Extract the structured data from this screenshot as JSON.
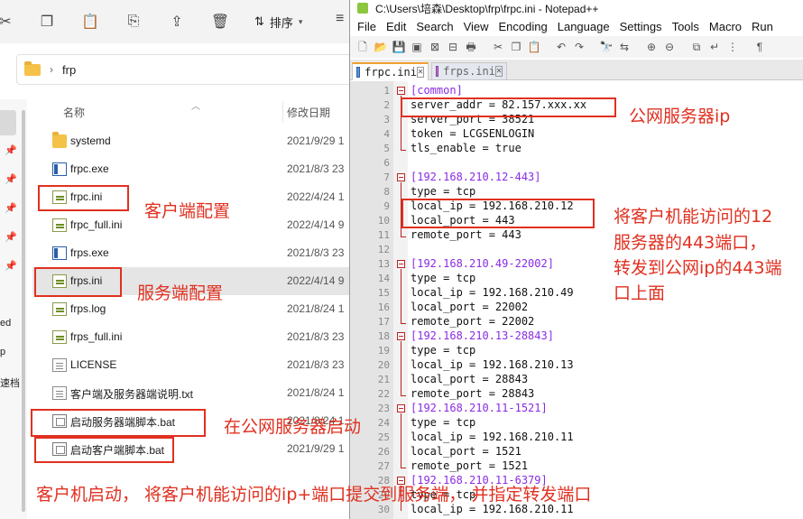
{
  "explorer": {
    "toolbar": {
      "sort_label": "排序"
    },
    "address": {
      "path": "frp"
    },
    "columns": {
      "name": "名称",
      "date": "修改日期"
    },
    "nav_fragments": [
      "ed",
      "p",
      "速档"
    ],
    "files": [
      {
        "name": "systemd",
        "date": "2021/9/29 1",
        "icon": "folder"
      },
      {
        "name": "frpc.exe",
        "date": "2021/8/3 23",
        "icon": "exe"
      },
      {
        "name": "frpc.ini",
        "date": "2022/4/24 1",
        "icon": "ini"
      },
      {
        "name": "frpc_full.ini",
        "date": "2022/4/14 9",
        "icon": "ini"
      },
      {
        "name": "frps.exe",
        "date": "2021/8/3 23",
        "icon": "exe"
      },
      {
        "name": "frps.ini",
        "date": "2022/4/14 9",
        "icon": "ini"
      },
      {
        "name": "frps.log",
        "date": "2021/8/24 1",
        "icon": "ini"
      },
      {
        "name": "frps_full.ini",
        "date": "2021/8/3 23",
        "icon": "ini"
      },
      {
        "name": "LICENSE",
        "date": "2021/8/3 23",
        "icon": "txt"
      },
      {
        "name": "客户端及服务器端说明.txt",
        "date": "2021/8/24 1",
        "icon": "txt"
      },
      {
        "name": "启动服务器端脚本.bat",
        "date": "2021/8/24 1",
        "icon": "bat"
      },
      {
        "name": "启动客户端脚本.bat",
        "date": "2021/9/29 1",
        "icon": "bat"
      }
    ]
  },
  "notepad": {
    "title": "C:\\Users\\培森\\Desktop\\frp\\frpc.ini - Notepad++",
    "menu": [
      "File",
      "Edit",
      "Search",
      "View",
      "Encoding",
      "Language",
      "Settings",
      "Tools",
      "Macro",
      "Run"
    ],
    "tabs": [
      {
        "label": "frpc.ini",
        "active": true
      },
      {
        "label": "frps.ini",
        "active": false
      }
    ],
    "lines": [
      {
        "n": "1",
        "text": "[common]",
        "sec": true
      },
      {
        "n": "2",
        "text": "server_addr = 82.157.xxx.xx"
      },
      {
        "n": "3",
        "text": "server_port = 38521"
      },
      {
        "n": "4",
        "text": "token = LCGSENLOGIN"
      },
      {
        "n": "5",
        "text": "tls_enable = true"
      },
      {
        "n": "6",
        "text": ""
      },
      {
        "n": "7",
        "text": "[192.168.210.12-443]",
        "sec": true
      },
      {
        "n": "8",
        "text": "type = tcp"
      },
      {
        "n": "9",
        "text": "local_ip = 192.168.210.12"
      },
      {
        "n": "10",
        "text": "local_port = 443"
      },
      {
        "n": "11",
        "text": "remote_port = 443"
      },
      {
        "n": "12",
        "text": ""
      },
      {
        "n": "13",
        "text": "[192.168.210.49-22002]",
        "sec": true
      },
      {
        "n": "14",
        "text": "type = tcp"
      },
      {
        "n": "15",
        "text": "local_ip = 192.168.210.49"
      },
      {
        "n": "16",
        "text": "local_port = 22002"
      },
      {
        "n": "17",
        "text": "remote_port = 22002"
      },
      {
        "n": "18",
        "text": "[192.168.210.13-28843]",
        "sec": true
      },
      {
        "n": "19",
        "text": "type = tcp"
      },
      {
        "n": "20",
        "text": "local_ip = 192.168.210.13"
      },
      {
        "n": "21",
        "text": "local_port = 28843"
      },
      {
        "n": "22",
        "text": "remote_port = 28843"
      },
      {
        "n": "23",
        "text": "[192.168.210.11-1521]",
        "sec": true
      },
      {
        "n": "24",
        "text": "type = tcp"
      },
      {
        "n": "25",
        "text": "local_ip = 192.168.210.11"
      },
      {
        "n": "26",
        "text": "local_port = 1521"
      },
      {
        "n": "27",
        "text": "remote_port = 1521"
      },
      {
        "n": "28",
        "text": "[192.168.210.11-6379]",
        "sec": true
      },
      {
        "n": "29",
        "text": "type = tcp"
      },
      {
        "n": "30",
        "text": "local_ip = 192.168.210.11"
      }
    ]
  },
  "annotations": {
    "client_config": "客户端配置",
    "server_config": "服务端配置",
    "start_on_public_server": "在公网服务器启动",
    "client_start": "客户机启动，  将客户机能访问的ip+端口提交到服务端，  并指定转发端口",
    "public_server_ip": "公网服务器ip",
    "forward_note_1": "将客户机能访问的12",
    "forward_note_2": "服务器的443端口，",
    "forward_note_3": "转发到公网ip的443端",
    "forward_note_4": "口上面"
  },
  "colors": {
    "annotation": "#e03020",
    "section": "#8a2be2",
    "fold_marker": "#bb2222"
  }
}
